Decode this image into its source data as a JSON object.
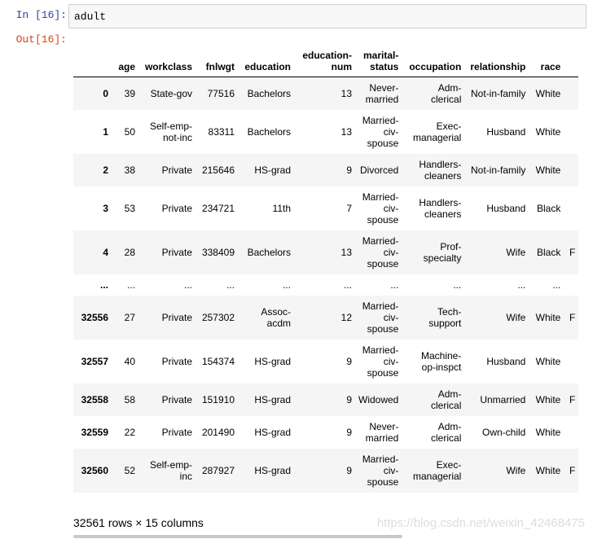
{
  "input_prompt": "In  [16]:",
  "output_prompt": "Out[16]:",
  "code": "adult",
  "table": {
    "columns": [
      "",
      "age",
      "workclass",
      "fnlwgt",
      "education",
      "education-\nnum",
      "marital-\nstatus",
      "occupation",
      "relationship",
      "race"
    ],
    "rows": [
      [
        "0",
        "39",
        "State-gov",
        "77516",
        "Bachelors",
        "13",
        "Never-\nmarried",
        "Adm-\nclerical",
        "Not-in-family",
        "White",
        ""
      ],
      [
        "1",
        "50",
        "Self-emp-\nnot-inc",
        "83311",
        "Bachelors",
        "13",
        "Married-\nciv-\nspouse",
        "Exec-\nmanagerial",
        "Husband",
        "White",
        ""
      ],
      [
        "2",
        "38",
        "Private",
        "215646",
        "HS-grad",
        "9",
        "Divorced",
        "Handlers-\ncleaners",
        "Not-in-family",
        "White",
        ""
      ],
      [
        "3",
        "53",
        "Private",
        "234721",
        "11th",
        "7",
        "Married-\nciv-\nspouse",
        "Handlers-\ncleaners",
        "Husband",
        "Black",
        ""
      ],
      [
        "4",
        "28",
        "Private",
        "338409",
        "Bachelors",
        "13",
        "Married-\nciv-\nspouse",
        "Prof-\nspecialty",
        "Wife",
        "Black",
        "F"
      ],
      [
        "...",
        "...",
        "...",
        "...",
        "...",
        "...",
        "...",
        "...",
        "...",
        "...",
        ""
      ],
      [
        "32556",
        "27",
        "Private",
        "257302",
        "Assoc-\nacdm",
        "12",
        "Married-\nciv-\nspouse",
        "Tech-\nsupport",
        "Wife",
        "White",
        "F"
      ],
      [
        "32557",
        "40",
        "Private",
        "154374",
        "HS-grad",
        "9",
        "Married-\nciv-\nspouse",
        "Machine-\nop-inspct",
        "Husband",
        "White",
        ""
      ],
      [
        "32558",
        "58",
        "Private",
        "151910",
        "HS-grad",
        "9",
        "Widowed",
        "Adm-\nclerical",
        "Unmarried",
        "White",
        "F"
      ],
      [
        "32559",
        "22",
        "Private",
        "201490",
        "HS-grad",
        "9",
        "Never-\nmarried",
        "Adm-\nclerical",
        "Own-child",
        "White",
        ""
      ],
      [
        "32560",
        "52",
        "Self-emp-\ninc",
        "287927",
        "HS-grad",
        "9",
        "Married-\nciv-\nspouse",
        "Exec-\nmanagerial",
        "Wife",
        "White",
        "F"
      ]
    ]
  },
  "summary": "32561 rows × 15 columns",
  "watermark": "https://blog.csdn.net/weixin_42468475"
}
